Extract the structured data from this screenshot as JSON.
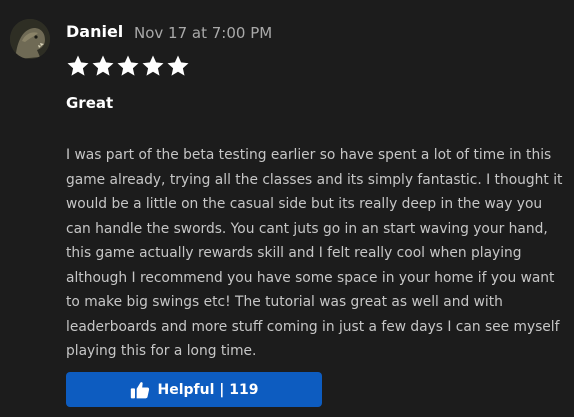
{
  "review": {
    "author": "Daniel",
    "timestamp": "Nov 17 at 7:00 PM",
    "rating": 5,
    "rating_max": 5,
    "title": "Great",
    "body": "I was part of the beta testing earlier so have spent a lot of time in this game already, trying all the classes and its simply fantastic. I thought it would be a little on the casual side but its really deep in the way you can handle the swords. You cant juts go in an start waving your hand, this game actually rewards skill and I felt really cool when playing although I recommend you have some space in your home if you want to make big swings etc! The tutorial was great as well and with leaderboards and more stuff coming in just a few days I can see myself playing this for a long time.",
    "helpful_button": {
      "label": "Helpful | 119",
      "icon": "thumbs-up-icon"
    }
  },
  "colors": {
    "background": "#1c1c1c",
    "star": "#ffffff",
    "button": "#0d5cc0",
    "timestamp": "#a9a9a9"
  }
}
